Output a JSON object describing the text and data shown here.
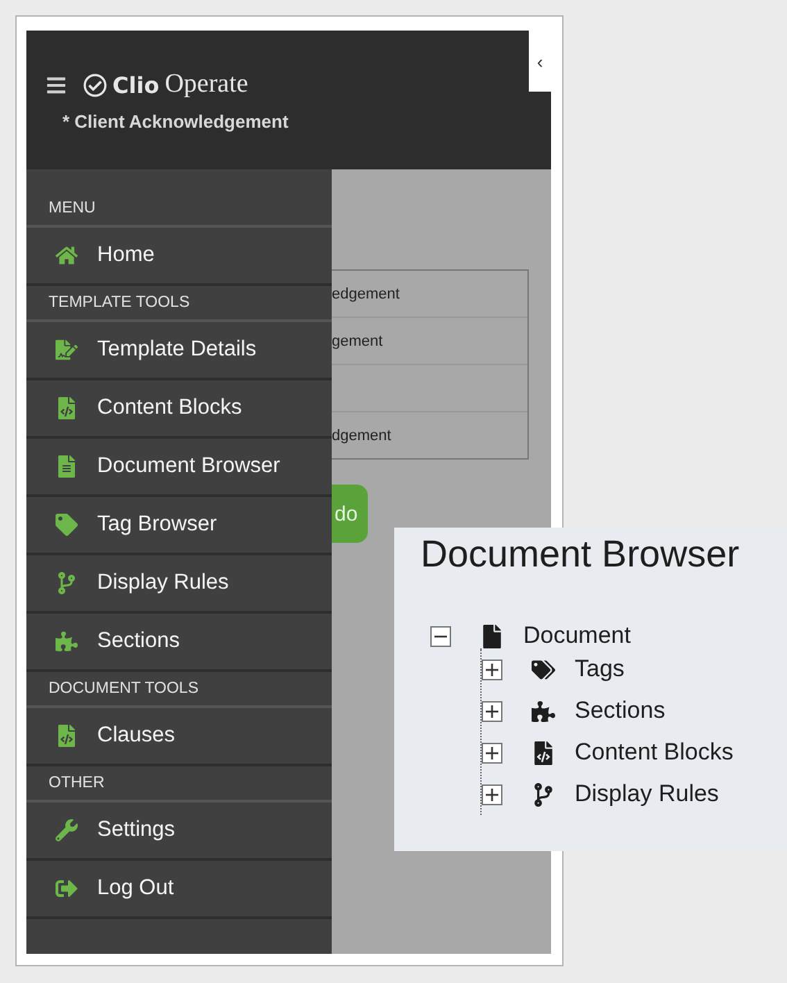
{
  "header": {
    "brand_bold": "Clio",
    "brand_light": "Operate",
    "document_title": "* Client Acknowledgement",
    "collapse_button": "‹"
  },
  "sidebar": {
    "sections": [
      {
        "heading": "MENU",
        "items": [
          {
            "label": "Home"
          }
        ]
      },
      {
        "heading": "TEMPLATE TOOLS",
        "items": [
          {
            "label": "Template Details"
          },
          {
            "label": "Content Blocks"
          },
          {
            "label": "Document Browser"
          },
          {
            "label": "Tag Browser"
          },
          {
            "label": "Display Rules"
          },
          {
            "label": "Sections"
          }
        ]
      },
      {
        "heading": "DOCUMENT TOOLS",
        "items": [
          {
            "label": "Clauses"
          }
        ]
      },
      {
        "heading": "OTHER",
        "items": [
          {
            "label": "Settings"
          },
          {
            "label": "Log Out"
          }
        ]
      }
    ]
  },
  "table": {
    "rows": [
      "edgement",
      "gement",
      "",
      "dgement"
    ]
  },
  "action_button": "do",
  "inset": {
    "title": "Document Browser",
    "tree": [
      {
        "label": "Document",
        "expanded": true,
        "children": [
          {
            "label": "Tags",
            "expanded": false
          },
          {
            "label": "Sections",
            "expanded": false
          },
          {
            "label": "Content Blocks",
            "expanded": false
          },
          {
            "label": "Display Rules",
            "expanded": false
          }
        ]
      }
    ]
  }
}
